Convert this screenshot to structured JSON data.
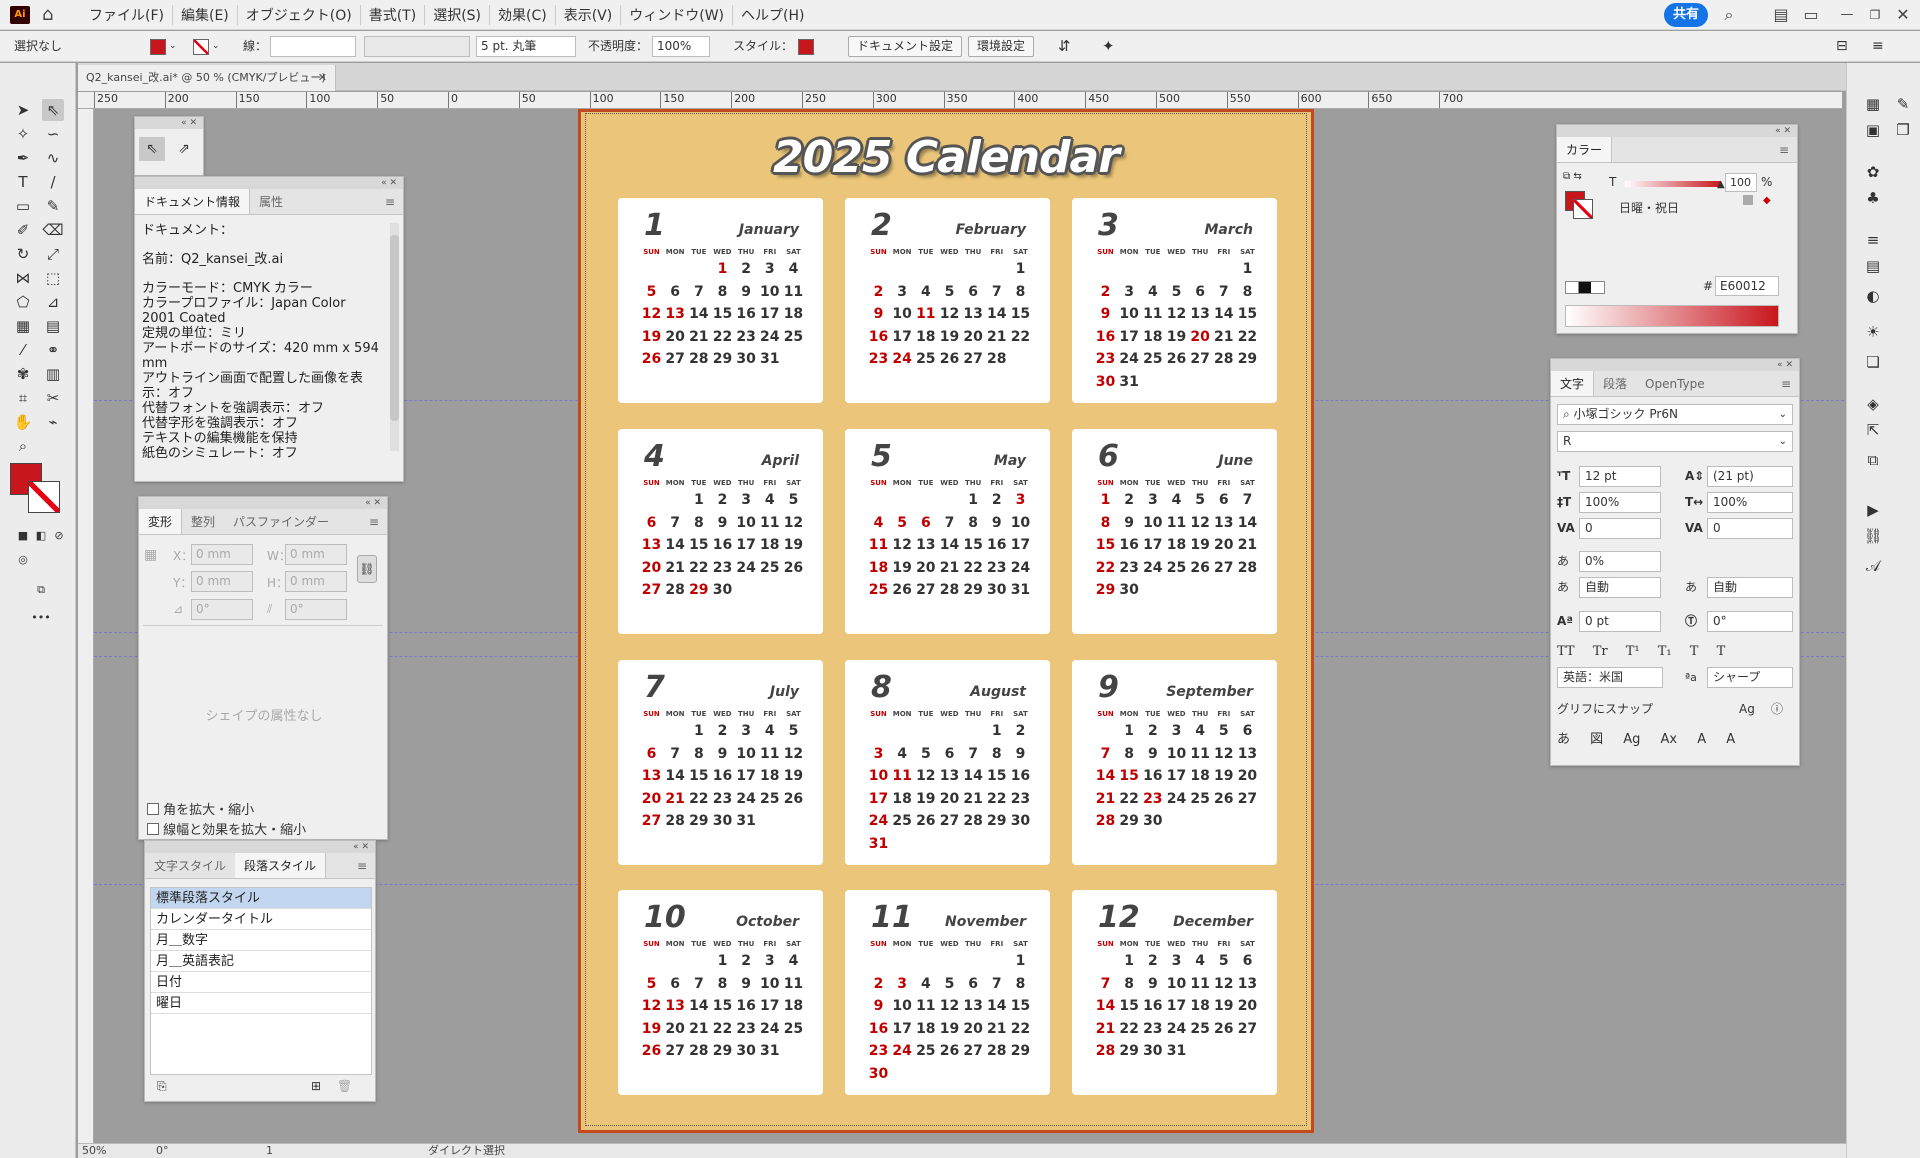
{
  "app": {
    "logo": "Ai",
    "share_label": "共有"
  },
  "menu": [
    "ファイル(F)",
    "編集(E)",
    "オブジェクト(O)",
    "書式(T)",
    "選択(S)",
    "効果(C)",
    "表示(V)",
    "ウィンドウ(W)",
    "ヘルプ(H)"
  ],
  "control": {
    "selection": "選択なし",
    "stroke_label": "線：",
    "brush": "5 pt. 丸筆",
    "opacity_label": "不透明度：",
    "opacity_value": "100%",
    "style_label": "スタイル：",
    "doc_setup": "ドキュメント設定",
    "prefs": "環境設定"
  },
  "doc_tab": {
    "title": "Q2_kansei_改.ai* @ 50 % (CMYK/プレビュー)"
  },
  "ruler": {
    "ticks": [
      "250",
      "200",
      "150",
      "100",
      "50",
      "0",
      "50",
      "100",
      "150",
      "200",
      "250",
      "300",
      "350",
      "400",
      "450",
      "500",
      "550",
      "600",
      "650",
      "700"
    ]
  },
  "status": {
    "zoom": "50%",
    "rotation": "0°",
    "artboard": "1",
    "tool": "ダイレクト選択"
  },
  "docinfo": {
    "tabs": [
      "ドキュメント情報",
      "属性"
    ],
    "heading": "ドキュメント：",
    "name": "名前：Q2_kansei_改.ai",
    "color_mode": "カラーモード：CMYK カラー",
    "profile": "カラープロファイル：Japan Color 2001 Coated",
    "units": "定規の単位：ミリ",
    "artboard_size": "アートボードのサイズ：420 mm x 594 mm",
    "outline": "アウトライン画面で配置した画像を表示：オフ",
    "sub_font": "代替フォントを強調表示：オフ",
    "sub_glyph": "代替字形を強調表示：オフ",
    "text_edit": "テキストの編集機能を保持",
    "cut": "紙色のシミュレート：オフ"
  },
  "transform": {
    "tabs": [
      "変形",
      "整列",
      "パスファインダー"
    ],
    "x_label": "X：",
    "y_label": "Y：",
    "w_label": "W：",
    "h_label": "H：",
    "x": "0 mm",
    "y": "0 mm",
    "w": "0 mm",
    "h": "0 mm",
    "angle": "0°",
    "shear": "0°",
    "empty": "シェイプの属性なし",
    "scale_corners": "角を拡大・縮小",
    "scale_strokes": "線幅と効果を拡大・縮小"
  },
  "styles": {
    "tabs": [
      "文字スタイル",
      "段落スタイル"
    ],
    "items": [
      "標準段落スタイル",
      "カレンダータイトル",
      "月＿数字",
      "月＿英語表記",
      "日付",
      "曜日"
    ]
  },
  "color": {
    "tab": "カラー",
    "tint_label": "T",
    "tint": "100",
    "pct": "%",
    "swatch_name": "日曜・祝日",
    "hex_label": "#",
    "hex": "E60012",
    "fill_color": "#c8161d"
  },
  "char": {
    "tabs": [
      "文字",
      "段落",
      "OpenType"
    ],
    "font": "小塚ゴシック Pr6N",
    "style": "R",
    "size": "12 pt",
    "leading": "(21 pt)",
    "vscale": "100%",
    "hscale": "100%",
    "kern": "0",
    "track": "0",
    "tsume": "0%",
    "aki1": "自動",
    "aki2": "自動",
    "baseline": "0 pt",
    "rotate": "0°",
    "lang": "英語：米国",
    "aa": "シャープ",
    "snap": "グリフにスナップ"
  },
  "calendar": {
    "title": "2025 Calendar",
    "weekdays": [
      "SUN",
      "MON",
      "TUE",
      "WED",
      "THU",
      "FRI",
      "SAT"
    ],
    "months": [
      {
        "num": "1",
        "name": "January",
        "offset": 3,
        "days": 31,
        "red": [
          1,
          5,
          12,
          13,
          19,
          26
        ]
      },
      {
        "num": "2",
        "name": "February",
        "offset": 6,
        "days": 28,
        "red": [
          2,
          9,
          11,
          16,
          23,
          24
        ]
      },
      {
        "num": "3",
        "name": "March",
        "offset": 6,
        "days": 31,
        "red": [
          2,
          9,
          16,
          20,
          23,
          30
        ]
      },
      {
        "num": "4",
        "name": "April",
        "offset": 2,
        "days": 30,
        "red": [
          6,
          13,
          20,
          27,
          29
        ]
      },
      {
        "num": "5",
        "name": "May",
        "offset": 4,
        "days": 31,
        "red": [
          3,
          4,
          5,
          6,
          11,
          18,
          25
        ]
      },
      {
        "num": "6",
        "name": "June",
        "offset": 0,
        "days": 30,
        "red": [
          1,
          8,
          15,
          22,
          29
        ]
      },
      {
        "num": "7",
        "name": "July",
        "offset": 2,
        "days": 31,
        "red": [
          6,
          13,
          20,
          21,
          27
        ]
      },
      {
        "num": "8",
        "name": "August",
        "offset": 5,
        "days": 31,
        "red": [
          3,
          10,
          11,
          17,
          24,
          31
        ]
      },
      {
        "num": "9",
        "name": "September",
        "offset": 1,
        "days": 30,
        "red": [
          7,
          14,
          15,
          21,
          23,
          28
        ]
      },
      {
        "num": "10",
        "name": "October",
        "offset": 3,
        "days": 31,
        "red": [
          5,
          12,
          13,
          19,
          26
        ]
      },
      {
        "num": "11",
        "name": "November",
        "offset": 6,
        "days": 30,
        "red": [
          2,
          3,
          9,
          16,
          23,
          24,
          30
        ]
      },
      {
        "num": "12",
        "name": "December",
        "offset": 1,
        "days": 31,
        "red": [
          7,
          14,
          21,
          28
        ]
      }
    ]
  }
}
